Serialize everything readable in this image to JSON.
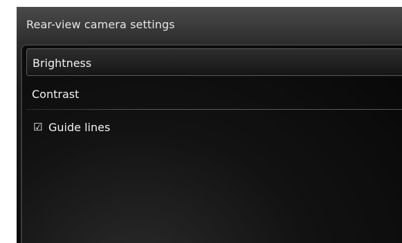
{
  "header": {
    "title": "Rear-view camera settings"
  },
  "menu": {
    "items": [
      {
        "label": "Brightness",
        "selected": true
      },
      {
        "label": "Contrast",
        "selected": false
      },
      {
        "label": "Guide lines",
        "checked": true,
        "checkbox_glyph": "☑"
      }
    ]
  },
  "colors": {
    "text": "#f2f2f2",
    "header_bg": "#3a3a3a",
    "panel_bg": "#0a0a0a",
    "selection_border": "#5a5a5a"
  }
}
